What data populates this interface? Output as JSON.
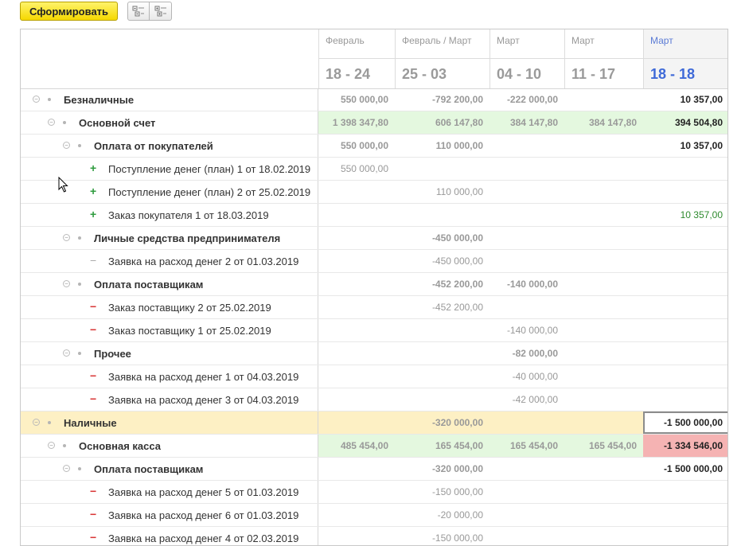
{
  "toolbar": {
    "generate_label": "Сформировать"
  },
  "header": {
    "columns": [
      {
        "month": "Февраль",
        "range": "18 - 24"
      },
      {
        "month": "Февраль / Март",
        "range": "25 - 03"
      },
      {
        "month": "Март",
        "range": "04 - 10"
      },
      {
        "month": "Март",
        "range": "11 - 17"
      },
      {
        "month": "Март",
        "range": "18 - 18"
      }
    ]
  },
  "rows": [
    {
      "level": 0,
      "kind": "group",
      "label": "Безналичные",
      "values": [
        "550 000,00",
        "-792 200,00",
        "-222 000,00",
        "",
        "10 357,00"
      ]
    },
    {
      "level": 1,
      "kind": "account",
      "label": "Основной счет",
      "values": [
        "1 398 347,80",
        "606 147,80",
        "384 147,80",
        "384 147,80",
        "394 504,80"
      ]
    },
    {
      "level": 2,
      "kind": "group",
      "label": "Оплата от покупателей",
      "values": [
        "550 000,00",
        "110 000,00",
        "",
        "",
        "10 357,00"
      ]
    },
    {
      "level": 3,
      "kind": "plus",
      "label": "Поступление денег (план) 1 от 18.02.2019",
      "values": [
        "550 000,00",
        "",
        "",
        "",
        ""
      ]
    },
    {
      "level": 3,
      "kind": "plus",
      "label": "Поступление денег (план) 2 от 25.02.2019",
      "values": [
        "",
        "110 000,00",
        "",
        "",
        ""
      ]
    },
    {
      "level": 3,
      "kind": "plus",
      "label": "Заказ покупателя 1 от 18.03.2019",
      "values": [
        "",
        "",
        "",
        "",
        "10 357,00"
      ]
    },
    {
      "level": 2,
      "kind": "group",
      "label": "Личные средства предпринимателя",
      "values": [
        "",
        "-450 000,00",
        "",
        "",
        ""
      ]
    },
    {
      "level": 3,
      "kind": "gray-minus",
      "label": "Заявка на расход денег 2 от 01.03.2019",
      "values": [
        "",
        "-450 000,00",
        "",
        "",
        ""
      ]
    },
    {
      "level": 2,
      "kind": "group",
      "label": "Оплата поставщикам",
      "values": [
        "",
        "-452 200,00",
        "-140 000,00",
        "",
        ""
      ]
    },
    {
      "level": 3,
      "kind": "minus",
      "label": "Заказ поставщику 2 от 25.02.2019",
      "values": [
        "",
        "-452 200,00",
        "",
        "",
        ""
      ]
    },
    {
      "level": 3,
      "kind": "minus",
      "label": "Заказ поставщику 1 от 25.02.2019",
      "values": [
        "",
        "",
        "-140 000,00",
        "",
        ""
      ]
    },
    {
      "level": 2,
      "kind": "group",
      "label": "Прочее",
      "values": [
        "",
        "",
        "-82 000,00",
        "",
        ""
      ]
    },
    {
      "level": 3,
      "kind": "minus",
      "label": "Заявка на расход денег 1 от 04.03.2019",
      "values": [
        "",
        "",
        "-40 000,00",
        "",
        ""
      ]
    },
    {
      "level": 3,
      "kind": "minus",
      "label": "Заявка на расход денег 3 от 04.03.2019",
      "values": [
        "",
        "",
        "-42 000,00",
        "",
        ""
      ]
    },
    {
      "level": 0,
      "kind": "cash",
      "label": "Наличные",
      "values": [
        "",
        "-320 000,00",
        "",
        "",
        "-1 500 000,00"
      ]
    },
    {
      "level": 1,
      "kind": "account-red",
      "label": "Основная касса",
      "values": [
        "485 454,00",
        "165 454,00",
        "165 454,00",
        "165 454,00",
        "-1 334 546,00"
      ]
    },
    {
      "level": 2,
      "kind": "group",
      "label": "Оплата поставщикам",
      "values": [
        "",
        "-320 000,00",
        "",
        "",
        "-1 500 000,00"
      ]
    },
    {
      "level": 3,
      "kind": "minus",
      "label": "Заявка на расход денег 5 от 01.03.2019",
      "values": [
        "",
        "-150 000,00",
        "",
        "",
        ""
      ]
    },
    {
      "level": 3,
      "kind": "minus",
      "label": "Заявка на расход денег 6 от 01.03.2019",
      "values": [
        "",
        "-20 000,00",
        "",
        "",
        ""
      ]
    },
    {
      "level": 3,
      "kind": "minus",
      "label": "Заявка на расход денег 4 от 02.03.2019",
      "values": [
        "",
        "-150 000,00",
        "",
        "",
        ""
      ]
    }
  ]
}
